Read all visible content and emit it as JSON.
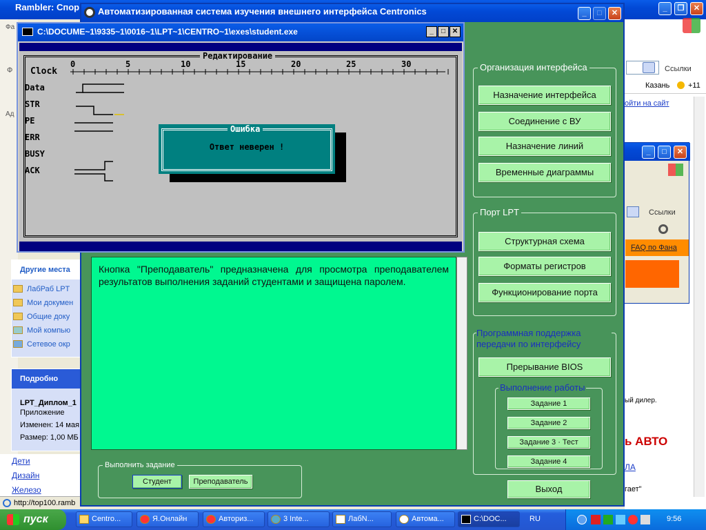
{
  "bg_windows": {
    "rambler_title": "Rambler: Спор",
    "addr_label": "Ад",
    "menu_fa": "Фа",
    "menu_f": "Ф",
    "search_label": "Ссылки",
    "search_label_2": "Ссылки",
    "kazan": "Казань",
    "temp": "+11",
    "go_site": "ойти на сайт",
    "faq": "FAQ по Фана",
    "dealer": "ый дилер.",
    "auto_brand": "ь АВТО",
    "la_link": "ЛА",
    "gaet": "гает\"",
    "status_url": "http://top100.ramb",
    "left_links": [
      "Дети",
      "Дизайн",
      "Железо"
    ]
  },
  "explorer_panel": {
    "other_places_title": "Другие места",
    "places": [
      "ЛабРаб LPT",
      "Мои докумен",
      "Общие доку",
      "Мой компью",
      "Сетевое окр"
    ],
    "details_title": "Подробно",
    "file_name": "LPT_Диплом_1",
    "file_type": "Приложение",
    "modified": "Изменен: 14 мая",
    "size": "Размер: 1,00 МБ"
  },
  "app": {
    "title": "Автоматизированная система изучения внешнего интерфейса Centronics",
    "description": "Кнопка \"Преподаватель\" предназначена для просмотра преподавателем результатов выполнения заданий студентами и защищена паролем.",
    "group_org": "Организация интерфейса",
    "btn_assign_iface": "Назначение интерфейса",
    "btn_connect": "Соединение с ВУ",
    "btn_lines": "Назначение линий",
    "btn_timing": "Временные диаграммы",
    "group_port": "Порт LPT",
    "btn_struct": "Структурная схема",
    "btn_formats": "Форматы регистров",
    "btn_func": "Функционирование порта",
    "group_soft": "Программная поддержка передачи по интерфейсу",
    "btn_bios": "Прерывание BIOS",
    "group_work": "Выполнение работы",
    "btn_task1": "Задание 1",
    "btn_task2": "Задание 2",
    "btn_task3": "Задание 3 · Тест",
    "btn_task4": "Задание 4",
    "btn_exit": "Выход",
    "group_do_task": "Выполнить задание",
    "btn_student": "Студент",
    "btn_teacher": "Преподаватель"
  },
  "dos": {
    "title": "C:\\DOCUME~1\\9335~1\\0016~1\\LPT~1\\CENTRO~1\\exes\\student.exe",
    "frame_title": "Редактирование",
    "clock_label": "Clock",
    "scale": [
      "0",
      "5",
      "10",
      "15",
      "20",
      "25",
      "30"
    ],
    "signals": [
      "Data",
      "STR",
      "PE",
      "ERR",
      "BUSY",
      "ACK"
    ],
    "error_title": "Ошибка",
    "error_msg": "Ответ неверен !"
  },
  "taskbar": {
    "start": "пуск",
    "items": [
      "Centro...",
      "Я.Онлайн",
      "Авториз...",
      "3 Inte...",
      "ЛабN...",
      "Автома...",
      "C:\\DOC..."
    ],
    "lang": "RU",
    "clock": "9:56"
  },
  "colors": {
    "app_bg": "#4a9460",
    "text_area": "#00f890",
    "button": "#a8f3a8",
    "dos_bg": "#c0c0c0",
    "dos_blue": "#000080",
    "dialog_teal": "#008080"
  }
}
